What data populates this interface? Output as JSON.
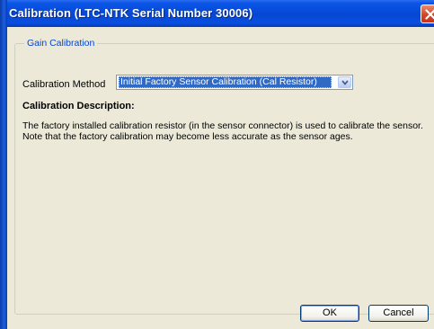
{
  "window": {
    "title": "Calibration (LTC-NTK Serial Number 30006)"
  },
  "group": {
    "title": "Gain Calibration"
  },
  "calibration_method": {
    "label": "Calibration Method",
    "selected": "Initial Factory Sensor Calibration (Cal Resistor)"
  },
  "description": {
    "heading": "Calibration Description:",
    "lines": [
      "The factory installed calibration resistor (in the sensor connector) is used to calibrate the sensor.",
      "Note that the factory calibration may become less accurate as the sensor ages."
    ]
  },
  "buttons": {
    "ok": "OK",
    "cancel": "Cancel"
  },
  "icons": {
    "close": "close-icon",
    "dropdown": "chevron-down-icon"
  },
  "colors": {
    "titlebar": "#0a55e6",
    "client_bg": "#ece9d8",
    "selection": "#316ac5",
    "group_title": "#0046d5",
    "close_button": "#d5442a"
  }
}
